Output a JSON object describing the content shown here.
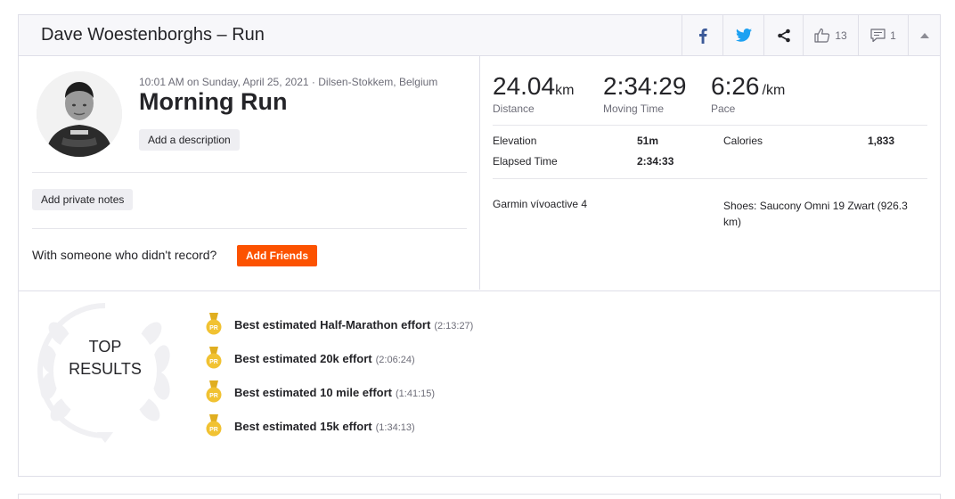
{
  "header": {
    "title": "Dave Woestenborghs – Run",
    "kudos_count": "13",
    "comments_count": "1"
  },
  "activity": {
    "meta": "10:01 AM on Sunday, April 25, 2021 · Dilsen-Stokkem, Belgium",
    "title": "Morning Run",
    "add_description_label": "Add a description",
    "add_private_notes_label": "Add private notes",
    "with_someone_text": "With someone who didn't record?",
    "add_friends_label": "Add Friends"
  },
  "stats": {
    "distance": {
      "value": "24.04",
      "unit": "km",
      "label": "Distance"
    },
    "moving_time": {
      "value": "2:34:29",
      "label": "Moving Time"
    },
    "pace": {
      "value": "6:26",
      "unit": "/km",
      "label": "Pace"
    },
    "elevation_label": "Elevation",
    "elevation_value": "51m",
    "calories_label": "Calories",
    "calories_value": "1,833",
    "elapsed_label": "Elapsed Time",
    "elapsed_value": "2:34:33",
    "device": "Garmin vívoactive 4",
    "shoes": "Shoes: Saucony Omni 19 Zwart (926.3 km)"
  },
  "top_results": {
    "label_line1": "TOP",
    "label_line2": "RESULTS",
    "items": [
      {
        "text": "Best estimated Half-Marathon effort",
        "time": "(2:13:27)"
      },
      {
        "text": "Best estimated 20k effort",
        "time": "(2:06:24)"
      },
      {
        "text": "Best estimated 10 mile effort",
        "time": "(1:41:15)"
      },
      {
        "text": "Best estimated 15k effort",
        "time": "(1:34:13)"
      }
    ],
    "badge_text": "PR"
  },
  "colors": {
    "brand_orange": "#fc5200",
    "facebook_blue": "#3b5998",
    "twitter_blue": "#1da1f2",
    "medal_gold": "#f1c232"
  }
}
